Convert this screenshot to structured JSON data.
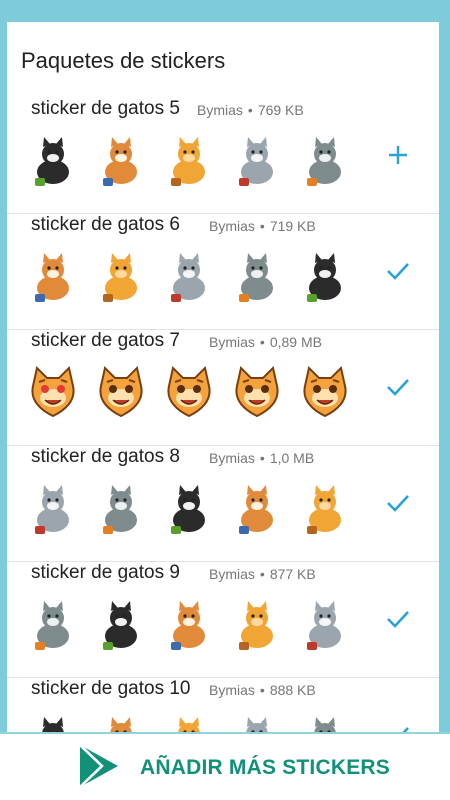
{
  "header": {
    "title": "Paquetes de stickers"
  },
  "packs": [
    {
      "name": "sticker de gatos 5",
      "author": "Bymias",
      "size": "769 KB",
      "action": "add-icon",
      "stickers": [
        "cat-white-black",
        "cat-hat-purple",
        "cat-bulldog-rose",
        "cat-black-flowers",
        "cat-white-branch"
      ]
    },
    {
      "name": "sticker de gatos 6",
      "author": "Bymias",
      "size": "719 KB",
      "action": "check-icon",
      "stickers": [
        "cat-orange-tophat",
        "cat-orange-cap",
        "cat-white-shirt",
        "cat-tabby-gray",
        "cat-hat-yellow"
      ]
    },
    {
      "name": "sticker de gatos 7",
      "author": "Bymias",
      "size": "0,89 MB",
      "action": "check-icon",
      "stickers": [
        "cat-emoji-heart-eyes",
        "cat-emoji-smile",
        "cat-emoji-laugh",
        "cat-emoji-happy",
        "cat-emoji-tears"
      ]
    },
    {
      "name": "sticker de gatos 8",
      "author": "Bymias",
      "size": "1,0 MB",
      "action": "check-icon",
      "stickers": [
        "cat-bow-red",
        "cat-white-sitting",
        "cat-clock",
        "cat-gray-lying",
        "cat-tabby-sitting"
      ]
    },
    {
      "name": "sticker de gatos 9",
      "author": "Bymias",
      "size": "877 KB",
      "action": "check-icon",
      "stickers": [
        "cats-pair-tabby",
        "cats-group-white",
        "cats-trio",
        "cats-flowers",
        "cats-trio-gray"
      ]
    },
    {
      "name": "sticker de gatos 10",
      "author": "Bymias",
      "size": "888 KB",
      "action": "check-icon",
      "stickers": [
        "cat-gray-partial",
        "cat-tiger-partial",
        "cat-red-partial",
        "cat-red-bow-partial",
        "cat-flowers-partial"
      ]
    }
  ],
  "bottom_bar": {
    "cta_label": "AÑADIR MÁS STICKERS",
    "icon": "play-store-icon"
  },
  "colors": {
    "accent": "#29a3d6",
    "cta": "#109178",
    "background": "#7ecbdc"
  }
}
